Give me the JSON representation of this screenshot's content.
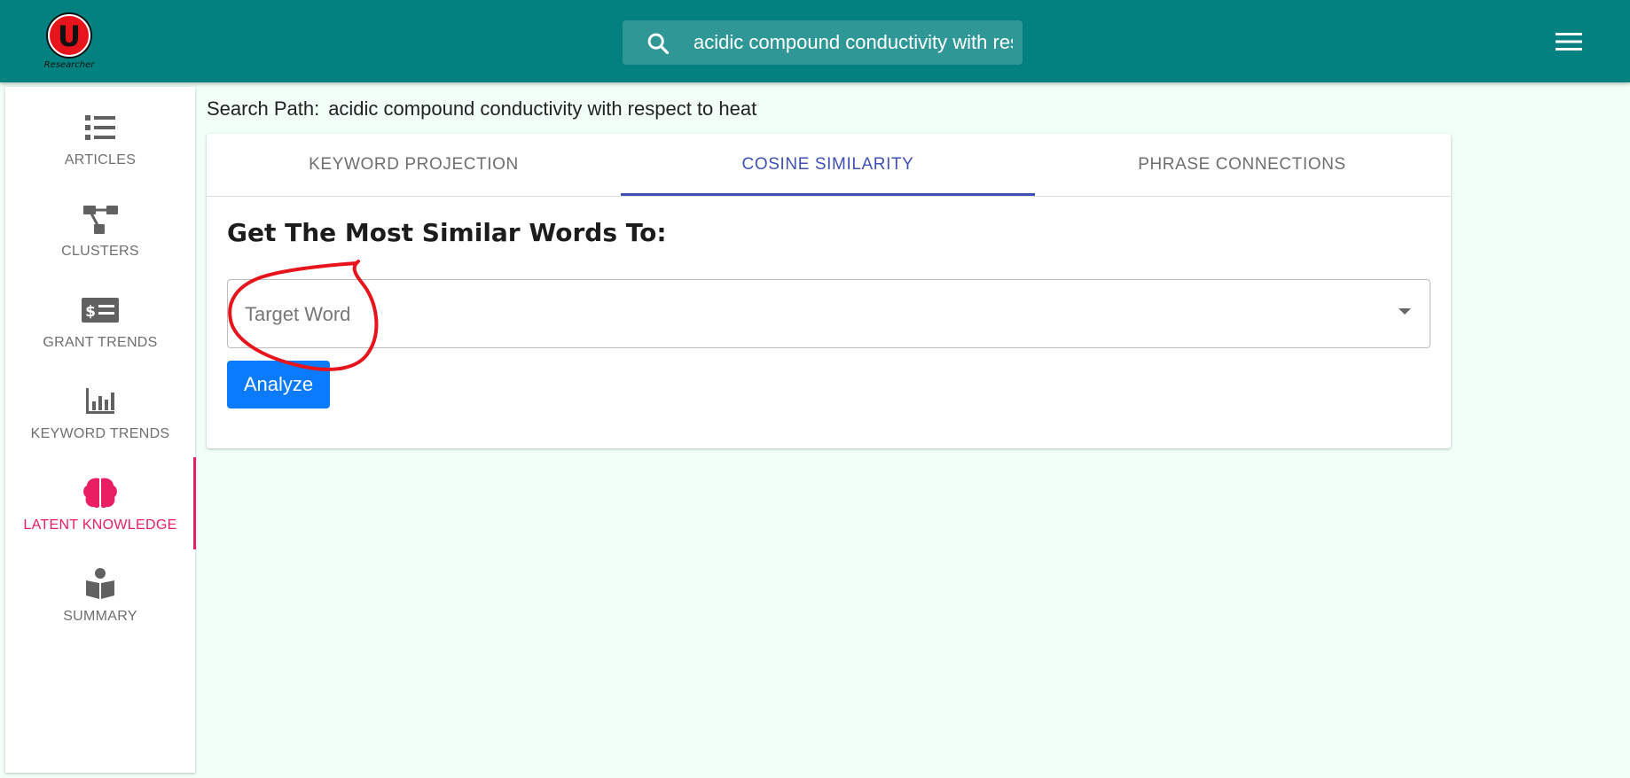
{
  "app": {
    "logo_letter": "U",
    "logo_text": "Researcher",
    "search_value": "acidic compound conductivity with respect to heat"
  },
  "sidebar": {
    "items": [
      {
        "label": "ARTICLES",
        "icon": "list-icon"
      },
      {
        "label": "CLUSTERS",
        "icon": "clusters-icon"
      },
      {
        "label": "GRANT TRENDS",
        "icon": "grant-icon"
      },
      {
        "label": "KEYWORD TRENDS",
        "icon": "bar-chart-icon"
      },
      {
        "label": "LATENT KNOWLEDGE",
        "icon": "brain-icon",
        "active": true
      },
      {
        "label": "SUMMARY",
        "icon": "reader-icon"
      }
    ]
  },
  "main": {
    "search_path_label": "Search Path:",
    "search_path_value": "acidic compound conductivity with respect to heat",
    "tabs": [
      {
        "label": "KEYWORD PROJECTION"
      },
      {
        "label": "COSINE SIMILARITY",
        "active": true
      },
      {
        "label": "PHRASE CONNECTIONS"
      }
    ],
    "heading": "Get The Most Similar Words To:",
    "target_placeholder": "Target Word",
    "analyze_label": "Analyze"
  },
  "colors": {
    "topbar": "#038181",
    "background": "#f1fff8",
    "active_nav": "#e91e63",
    "active_tab": "#3f51b5",
    "button": "#0a7bff",
    "annotation": "#e8141c"
  }
}
